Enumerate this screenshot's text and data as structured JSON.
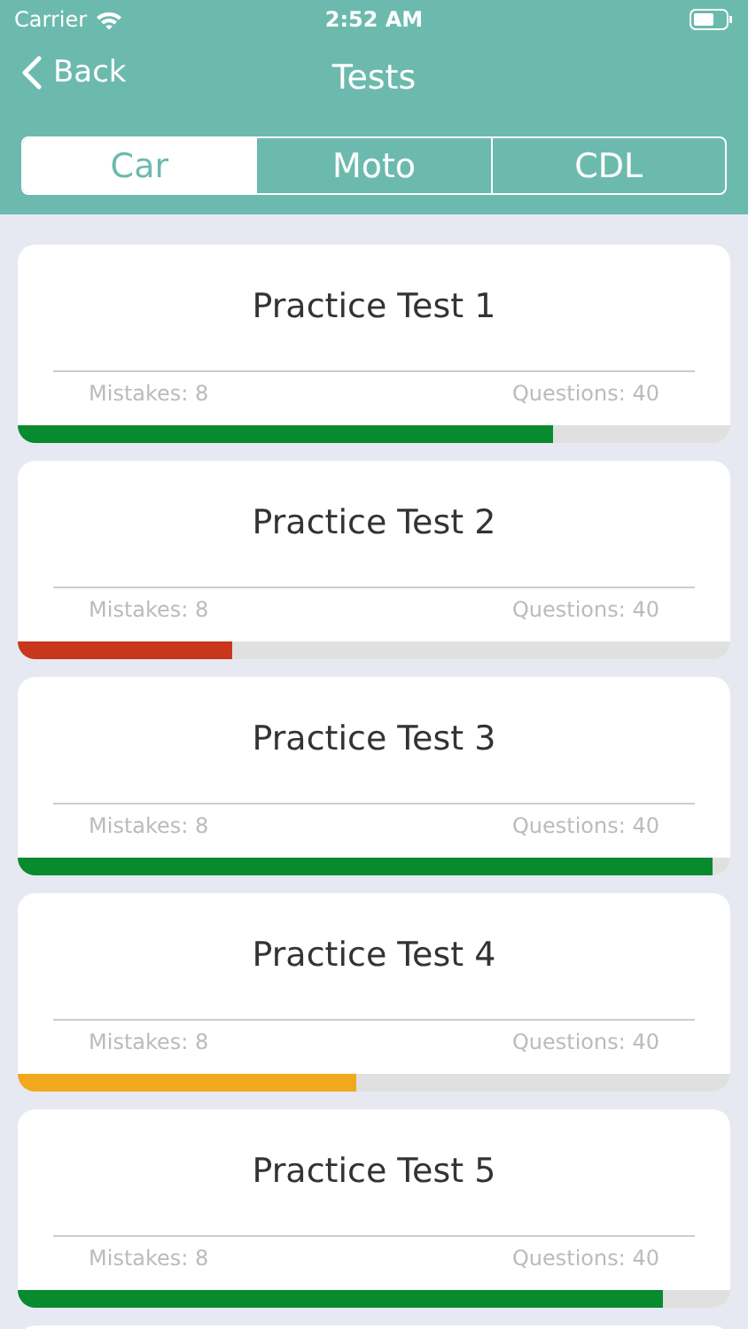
{
  "status_bar": {
    "carrier": "Carrier",
    "time": "2:52 AM"
  },
  "nav": {
    "back": "Back",
    "title": "Tests"
  },
  "tabs": [
    {
      "label": "Car",
      "selected": true
    },
    {
      "label": "Moto",
      "selected": false
    },
    {
      "label": "CDL",
      "selected": false
    }
  ],
  "tests": [
    {
      "title": "Practice Test 1",
      "mistakes": "Mistakes: 8",
      "questions": "Questions: 40",
      "level": 0.75,
      "color": "#088a2e"
    },
    {
      "title": "Practice Test 2",
      "mistakes": "Mistakes: 8",
      "questions": "Questions: 40",
      "level": 0.3,
      "color": "#c8361b"
    },
    {
      "title": "Practice Test 3",
      "mistakes": "Mistakes: 8",
      "questions": "Questions: 40",
      "level": 0.975,
      "color": "#088a2e"
    },
    {
      "title": "Practice Test 4",
      "mistakes": "Mistakes: 8",
      "questions": "Questions: 40",
      "level": 0.475,
      "color": "#f2a81d"
    },
    {
      "title": "Practice Test 5",
      "mistakes": "Mistakes: 8",
      "questions": "Questions: 40",
      "level": 0.905,
      "color": "#088a2e"
    }
  ]
}
